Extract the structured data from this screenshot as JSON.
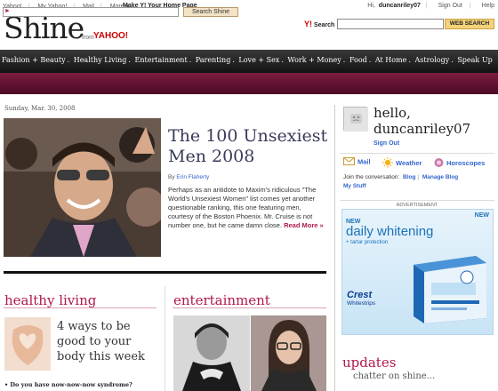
{
  "topbar": {
    "links": [
      "Yahoo!",
      "My Yahoo!",
      "Mail",
      "More ▾"
    ],
    "make_home": "Make Y! Your Home Page",
    "greeting": "Hi,",
    "username": "duncanriley07",
    "sign_out": "Sign Out",
    "help": "Help"
  },
  "logo": {
    "text": "Shine",
    "from": "from",
    "yahoo": "YAHOO!"
  },
  "search": {
    "brand": "Search",
    "button": "WEB SEARCH",
    "value": ""
  },
  "nav": {
    "items": [
      "Fashion + Beauty",
      "Healthy Living",
      "Entertainment",
      "Parenting",
      "Love + Sex",
      "Work + Money",
      "Food",
      "At Home",
      "Astrology",
      "Speak Up"
    ]
  },
  "shine_search": {
    "button": "Search Shine",
    "value": ""
  },
  "date": "Sunday, Mar. 30, 2008",
  "feature": {
    "title": "The 100 Unsexiest Men 2008",
    "author_prefix": "By",
    "author": "Erin Flaherty",
    "body": "Perhaps as an antidote to Maxim's ridiculous \"The World's Unsexiest Women\" list comes yet another questionable ranking, this one featuring men, courtesy of the Boston Phoenix. Mr. Cruise is not number one, but he came damn close.",
    "read_more": "Read More »"
  },
  "healthy_living": {
    "title": "healthy living",
    "story": "4 ways to be good to your body this week",
    "bullet": "Do you have now-now-now syndrome?"
  },
  "entertainment": {
    "title": "entertainment"
  },
  "sidebar": {
    "hello": "hello,",
    "username": "duncanriley07",
    "sign_out": "Sign Out",
    "services": [
      "Mail",
      "Weather",
      "Horoscopes"
    ],
    "conversation_prefix": "Join the conversation:",
    "blog": "Blog",
    "manage_blog": "Manage Blog",
    "my_stuff": "My Stuff",
    "ad_label": "ADVERTISEMENT",
    "updates_title": "updates",
    "updates_sub": "chatter on shine..."
  },
  "ad": {
    "new": "NEW",
    "headline": "daily whitening",
    "sub": "+ tartar protection",
    "brand": "Crest",
    "product": "Whitestrips"
  },
  "colors": {
    "accent": "#b0184a",
    "link": "#3366cc",
    "nav_bg": "#1a1a1a",
    "bar_bg": "#5e0f30"
  }
}
